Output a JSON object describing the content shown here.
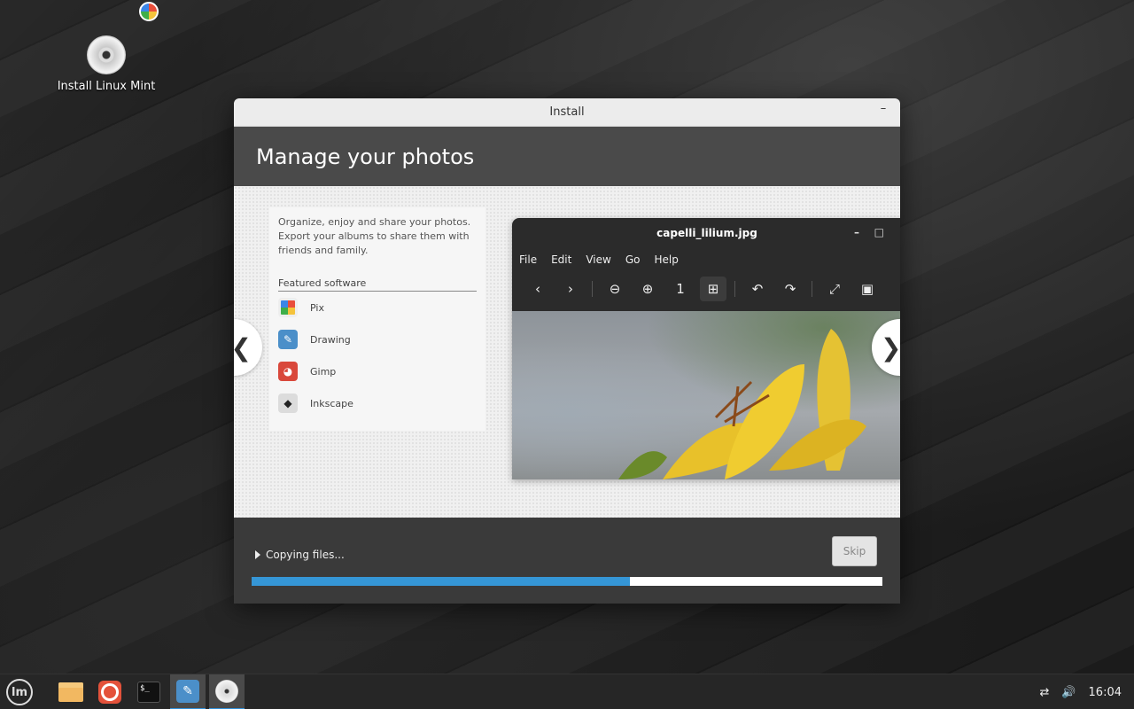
{
  "desktop": {
    "icon_label": "Install Linux Mint"
  },
  "window": {
    "title": "Install",
    "minimize": "–",
    "header": "Manage your photos"
  },
  "slide": {
    "description": "Organize, enjoy and share your photos. Export your albums to share them with friends and family.",
    "featured_title": "Featured software",
    "apps": [
      {
        "name": "Pix",
        "icon": "pix-icon",
        "color": "#e8e8e8"
      },
      {
        "name": "Drawing",
        "icon": "drawing-icon",
        "color": "#4b8fc9"
      },
      {
        "name": "Gimp",
        "icon": "gimp-icon",
        "color": "#d9483b"
      },
      {
        "name": "Inkscape",
        "icon": "inkscape-icon",
        "color": "#dcdcdc"
      }
    ],
    "prev_arrow": "❮",
    "next_arrow": "❯"
  },
  "viewer": {
    "title": "capelli_lilium.jpg",
    "menu": [
      "File",
      "Edit",
      "View",
      "Go",
      "Help"
    ],
    "toolbar": [
      "‹",
      "›",
      "⊖",
      "⊕",
      "1",
      "⊞",
      "↶",
      "↷",
      "⤢",
      "▣"
    ]
  },
  "progress": {
    "status": "Copying files...",
    "skip_label": "Skip",
    "fraction": 0.6,
    "bar_color": "#3596d6"
  },
  "taskbar": {
    "clock": "16:04",
    "network_icon": "⇄",
    "volume_icon": "🔊",
    "terminal_prompt": "$_"
  }
}
